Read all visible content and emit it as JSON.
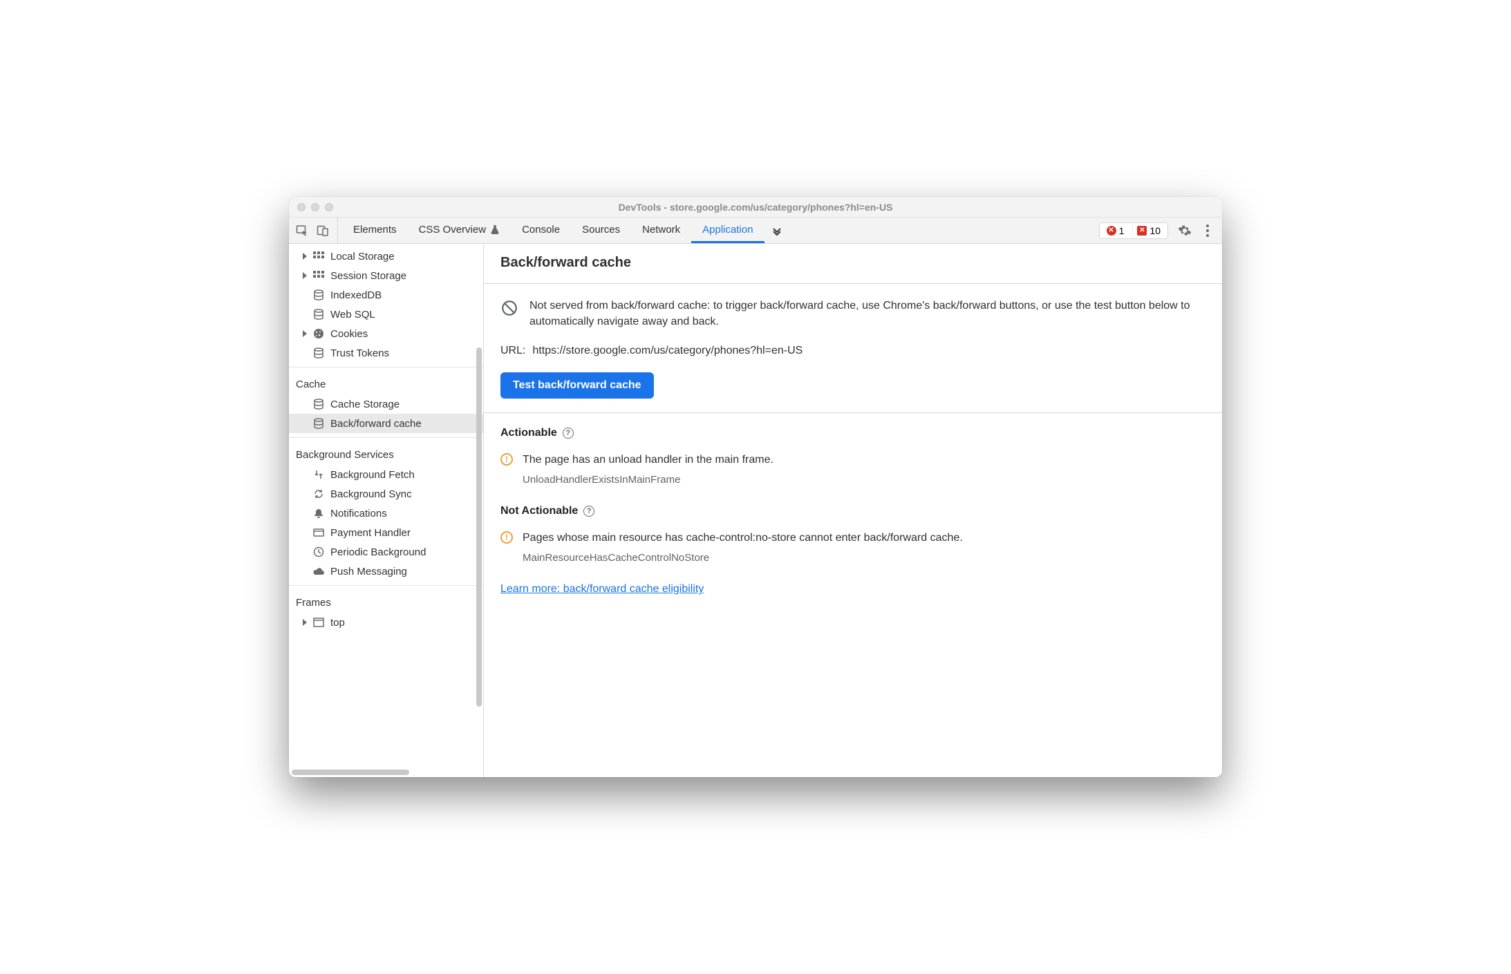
{
  "window": {
    "title": "DevTools - store.google.com/us/category/phones?hl=en-US"
  },
  "toolbar": {
    "tabs": [
      "Elements",
      "CSS Overview",
      "Console",
      "Sources",
      "Network",
      "Application"
    ],
    "active_tab": "Application",
    "error_count": "1",
    "blocked_count": "10"
  },
  "sidebar": {
    "storage": {
      "items": [
        {
          "label": "Local Storage",
          "icon": "storage-grid",
          "expandable": true
        },
        {
          "label": "Session Storage",
          "icon": "storage-grid",
          "expandable": true
        },
        {
          "label": "IndexedDB",
          "icon": "db-stack",
          "expandable": false
        },
        {
          "label": "Web SQL",
          "icon": "db-stack",
          "expandable": false
        },
        {
          "label": "Cookies",
          "icon": "cookie",
          "expandable": true
        },
        {
          "label": "Trust Tokens",
          "icon": "db-stack",
          "expandable": false
        }
      ]
    },
    "cache": {
      "heading": "Cache",
      "items": [
        {
          "label": "Cache Storage",
          "icon": "db-stack"
        },
        {
          "label": "Back/forward cache",
          "icon": "db-stack",
          "selected": true
        }
      ]
    },
    "background": {
      "heading": "Background Services",
      "items": [
        {
          "label": "Background Fetch",
          "icon": "fetch"
        },
        {
          "label": "Background Sync",
          "icon": "sync"
        },
        {
          "label": "Notifications",
          "icon": "bell"
        },
        {
          "label": "Payment Handler",
          "icon": "card"
        },
        {
          "label": "Periodic Background",
          "icon": "clock"
        },
        {
          "label": "Push Messaging",
          "icon": "cloud"
        }
      ]
    },
    "frames": {
      "heading": "Frames",
      "items": [
        {
          "label": "top",
          "icon": "frame",
          "expandable": true
        }
      ]
    }
  },
  "main": {
    "title": "Back/forward cache",
    "notice": "Not served from back/forward cache: to trigger back/forward cache, use Chrome's back/forward buttons, or use the test button below to automatically navigate away and back.",
    "url_label": "URL:",
    "url_value": "https://store.google.com/us/category/phones?hl=en-US",
    "test_button": "Test back/forward cache",
    "groups": {
      "actionable": {
        "title": "Actionable",
        "issues": [
          {
            "text": "The page has an unload handler in the main frame.",
            "code": "UnloadHandlerExistsInMainFrame"
          }
        ]
      },
      "not_actionable": {
        "title": "Not Actionable",
        "issues": [
          {
            "text": "Pages whose main resource has cache-control:no-store cannot enter back/forward cache.",
            "code": "MainResourceHasCacheControlNoStore"
          }
        ]
      }
    },
    "learn_more": "Learn more: back/forward cache eligibility"
  }
}
